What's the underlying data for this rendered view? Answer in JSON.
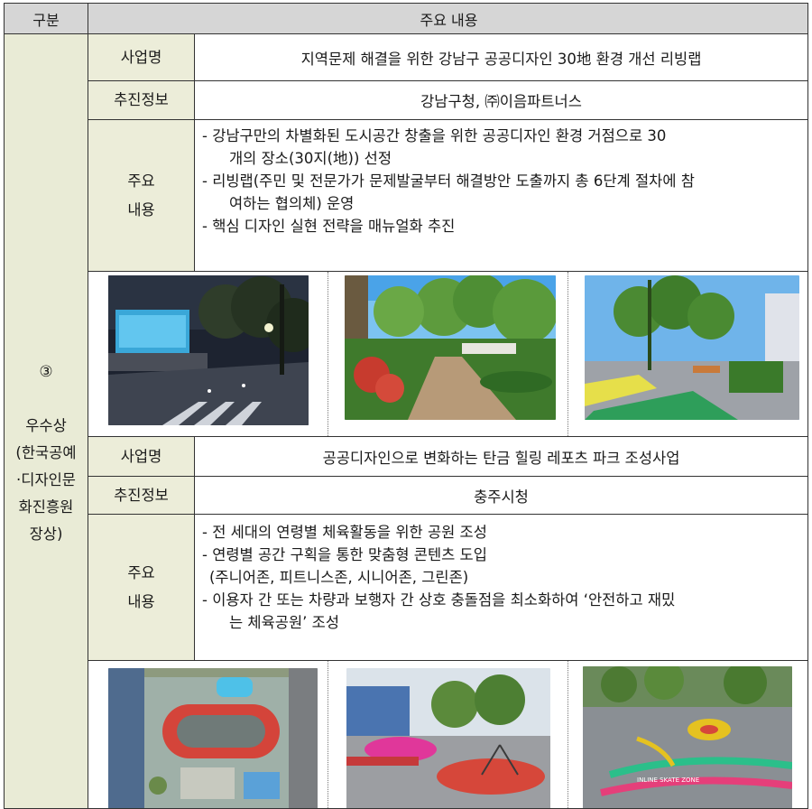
{
  "header": {
    "col1": "구분",
    "col2": "주요 내용"
  },
  "category": {
    "number": "③",
    "lines": [
      "우수상",
      "(한국공예",
      "·디자인문",
      "화진흥원",
      "장상)"
    ]
  },
  "sections": [
    {
      "name_label": "사업명",
      "name_value": "지역문제 해결을 위한 강남구 공공디자인 30地 환경 개선 리빙랩",
      "info_label": "추진정보",
      "info_value": "강남구청, ㈜이음파트너스",
      "content_label_1": "주요",
      "content_label_2": "내용",
      "content_lines": [
        {
          "type": "item",
          "text": "- 강남구만의 차별화된 도시공간 창출을 위한 공공디자인 환경 거점으로 30"
        },
        {
          "type": "cont",
          "text": "개의 장소(30지(地)) 선정"
        },
        {
          "type": "item",
          "text": "- 리빙랩(주민 및 전문가가 문제발굴부터 해결방안 도출까지 총 6단계 절차에 참"
        },
        {
          "type": "cont",
          "text": "여하는 협의체) 운영"
        },
        {
          "type": "item",
          "text": "- 핵심 디자인 실현 전략을 매뉴얼화 추진"
        }
      ]
    },
    {
      "name_label": "사업명",
      "name_value": "공공디자인으로 변화하는 탄금 힐링 레포츠 파크 조성사업",
      "info_label": "추진정보",
      "info_value": "충주시청",
      "content_label_1": "주요",
      "content_label_2": "내용",
      "content_lines": [
        {
          "type": "item",
          "text": "- 전 세대의 연령별 체육활동을 위한 공원 조성"
        },
        {
          "type": "item",
          "text": "- 연령별 공간 구획을 통한 맞춤형 콘텐츠 도입"
        },
        {
          "type": "plain",
          "text": "(주니어존, 피트니스존, 시니어존, 그린존)"
        },
        {
          "type": "item",
          "text": "- 이용자 간 또는 차량과 보행자 간 상호 충돌점을 최소화하여 ‘안전하고 재밌"
        },
        {
          "type": "cont",
          "text": "는 체육공원’ 조성"
        }
      ]
    }
  ],
  "photo_text": {
    "skate_zone": "INLINE SKATE ZONE"
  },
  "colors": {
    "header_bg": "#d6d6d6",
    "category_bg": "#e9ebd6",
    "label_bg": "#ecedd9",
    "border": "#333333"
  }
}
